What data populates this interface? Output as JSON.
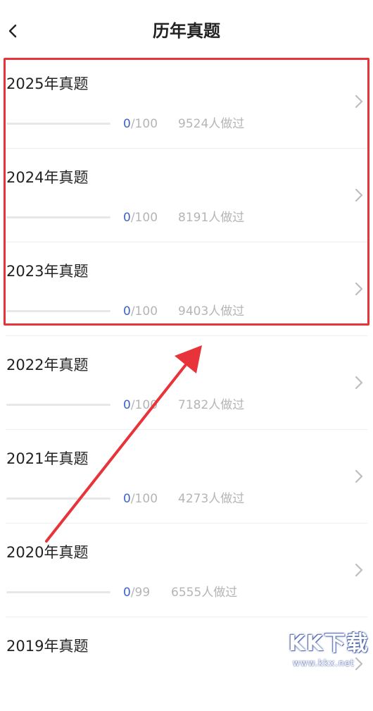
{
  "header": {
    "title": "历年真题",
    "back_icon": "chevron-left-icon"
  },
  "exams": [
    {
      "title": "2025年真题",
      "done": "0",
      "total": "/100",
      "taken": "9524人做过",
      "progress": 0
    },
    {
      "title": "2024年真题",
      "done": "0",
      "total": "/100",
      "taken": "8191人做过",
      "progress": 0
    },
    {
      "title": "2023年真题",
      "done": "0",
      "total": "/100",
      "taken": "9403人做过",
      "progress": 0
    },
    {
      "title": "2022年真题",
      "done": "0",
      "total": "/100",
      "taken": "7182人做过",
      "progress": 0
    },
    {
      "title": "2021年真题",
      "done": "0",
      "total": "/100",
      "taken": "4273人做过",
      "progress": 0
    },
    {
      "title": "2020年真题",
      "done": "0",
      "total": "/99",
      "taken": "6555人做过",
      "progress": 0
    },
    {
      "title": "2019年真题",
      "done": "",
      "total": "",
      "taken": "",
      "progress": 0
    }
  ],
  "watermark": {
    "text": "KK下载",
    "url": "www.kkx.net"
  },
  "colors": {
    "accent": "#3e63c9",
    "highlight": "#e8333a",
    "muted": "#b5b5b5"
  }
}
